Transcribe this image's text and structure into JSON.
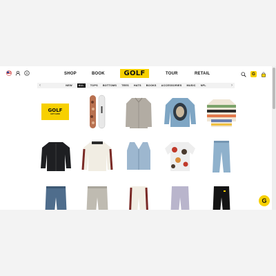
{
  "header": {
    "nav_left": [
      "SHOP",
      "BOOK"
    ],
    "logo": "GOLF",
    "nav_right": [
      "TOUR",
      "RETAIL"
    ],
    "left_icons": [
      "flag-icon",
      "user-icon",
      "info-icon"
    ],
    "right_icons": [
      "search-icon",
      "g-badge-icon",
      "bag-icon"
    ],
    "g_badge": "G"
  },
  "categories": {
    "items": [
      "NEW",
      "ALL",
      "TOPS",
      "BOTTOMS",
      "TEES",
      "HATS",
      "BOOKS",
      "ACCESSORIES",
      "MUSIC",
      "NFL"
    ],
    "active": "ALL",
    "prev_arrow": "‹",
    "next_arrow": "›"
  },
  "products": [
    {
      "name": "gift-card",
      "title": "GOLF",
      "subtitle": "GIFT CARD"
    },
    {
      "name": "snowboards"
    },
    {
      "name": "grey-jacket"
    },
    {
      "name": "portrait-denim-jacket"
    },
    {
      "name": "striped-sweater"
    },
    {
      "name": "black-cardigan"
    },
    {
      "name": "cream-track-jacket"
    },
    {
      "name": "denim-vest"
    },
    {
      "name": "graphic-shirt"
    },
    {
      "name": "light-jeans"
    },
    {
      "name": "dark-jeans"
    },
    {
      "name": "grey-pants"
    },
    {
      "name": "track-pants"
    },
    {
      "name": "lavender-pants"
    },
    {
      "name": "black-pants"
    }
  ],
  "fab": "G",
  "colors": {
    "brand_yellow": "#f7d000"
  }
}
